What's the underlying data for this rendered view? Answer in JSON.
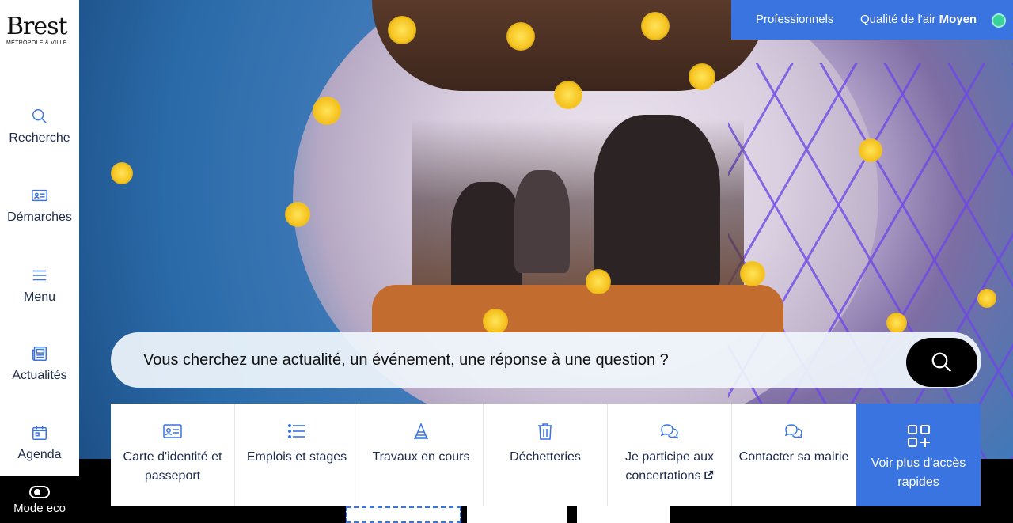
{
  "logo": {
    "brand": "Brest",
    "subtitle": "MÉTROPOLE & VILLE"
  },
  "sidebar": {
    "items": [
      {
        "label": "Recherche",
        "icon": "search-icon"
      },
      {
        "label": "Démarches",
        "icon": "id-card-icon"
      },
      {
        "label": "Menu",
        "icon": "menu-icon"
      },
      {
        "label": "Actualités",
        "icon": "newspaper-icon"
      },
      {
        "label": "Agenda",
        "icon": "calendar-icon"
      }
    ],
    "mode_eco": "Mode eco"
  },
  "topbar": {
    "professionnels": "Professionnels",
    "air_label": "Qualité de l'air",
    "air_value": "Moyen",
    "air_color": "#39d39a"
  },
  "search": {
    "placeholder": "Vous cherchez une actualité, un événement, une réponse à une question ?"
  },
  "quick_access": [
    {
      "label": "Carte d'identité et passeport",
      "icon": "id-card-icon"
    },
    {
      "label": "Emplois et stages",
      "icon": "list-icon"
    },
    {
      "label": "Travaux en cours",
      "icon": "roadwork-icon"
    },
    {
      "label": "Déchetteries",
      "icon": "trash-icon"
    },
    {
      "label": "Je participe aux concertations",
      "icon": "chat-icon",
      "external": true
    },
    {
      "label": "Contacter sa mairie",
      "icon": "chat-icon"
    },
    {
      "label": "Voir plus d'accès rapides",
      "icon": "grid-plus-icon"
    }
  ],
  "colors": {
    "accent": "#3a74e0",
    "text": "#1d2b4c"
  }
}
